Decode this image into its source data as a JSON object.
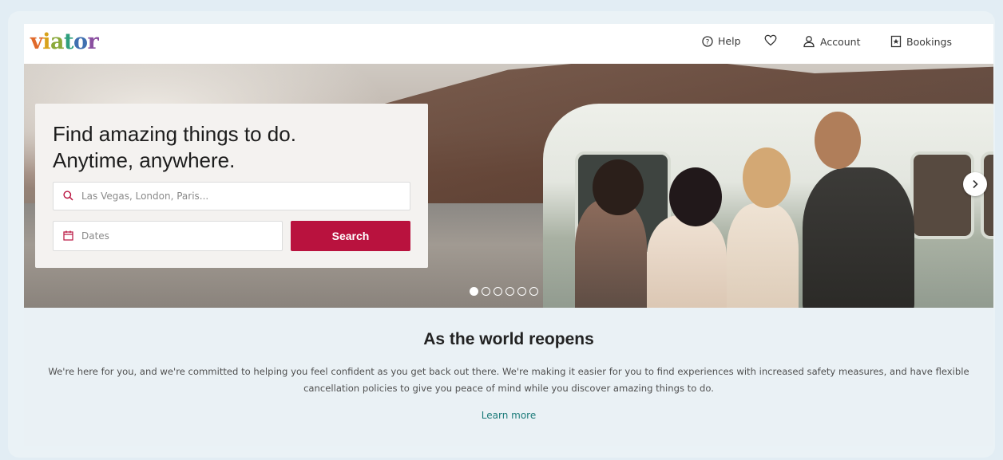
{
  "header": {
    "logo": "viator",
    "nav": {
      "help": "Help",
      "account": "Account",
      "bookings": "Bookings"
    }
  },
  "hero": {
    "title_line1": "Find amazing things to do.",
    "title_line2": "Anytime, anywhere.",
    "search": {
      "placeholder": "Las Vegas, London, Paris..."
    },
    "dates": {
      "placeholder": "Dates"
    },
    "search_button": "Search",
    "carousel": {
      "slide_count": 6,
      "active_index": 0
    }
  },
  "reopen": {
    "title": "As the world reopens",
    "body": "We're here for you, and we're committed to helping you feel confident as you get back out there. We're making it easier for you to find experiences with increased safety measures, and have flexible cancellation policies to give you peace of mind while you discover amazing things to do.",
    "link": "Learn more"
  },
  "colors": {
    "brand_red": "#b9123e",
    "link_teal": "#1a7a78"
  },
  "icons": [
    "help-icon",
    "heart-icon",
    "account-icon",
    "bookings-icon",
    "search-icon",
    "calendar-icon",
    "chevron-right-icon"
  ]
}
